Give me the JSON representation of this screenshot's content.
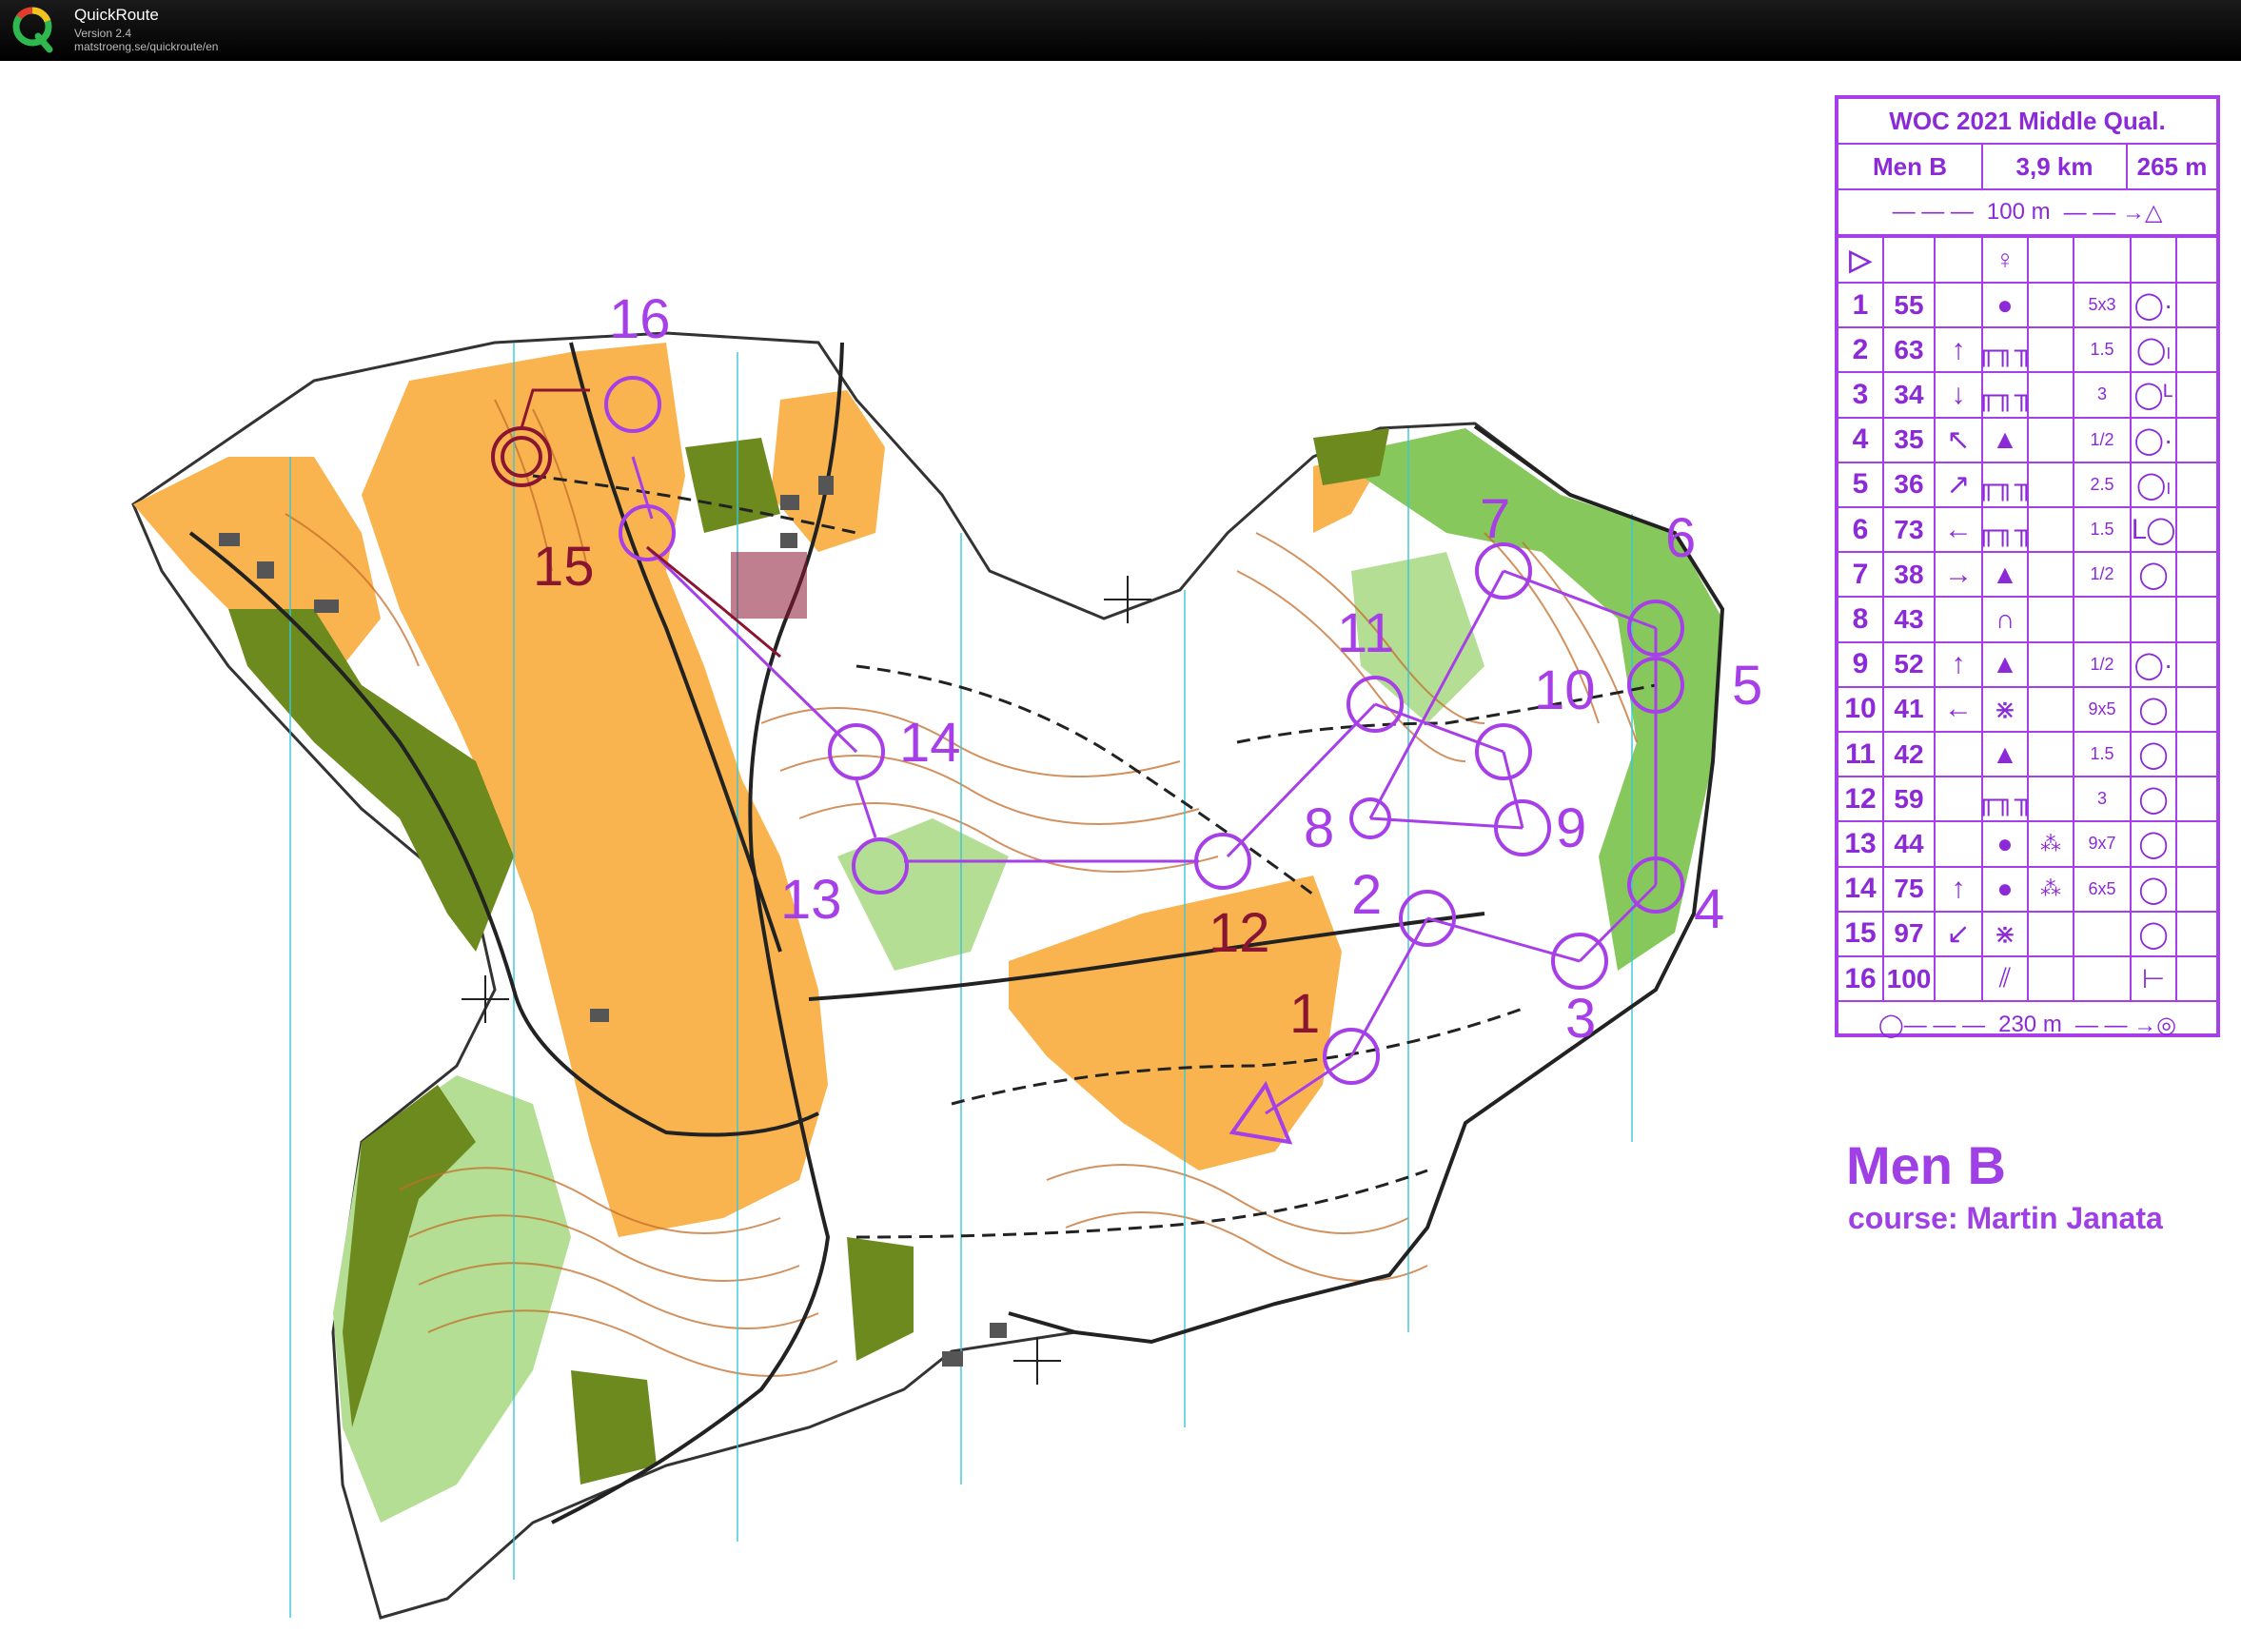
{
  "app": {
    "name": "QuickRoute",
    "version": "Version 2.4",
    "url": "matstroeng.se/quickroute/en"
  },
  "colors": {
    "course": "#a63fe8",
    "route": "#8a1531",
    "open_land": "#f9b450",
    "forest_green": "#85c55a",
    "olive": "#6d8a1f",
    "contour": "#c46e2a"
  },
  "description_sheet": {
    "event": "WOC 2021 Middle Qual.",
    "class": "Men B",
    "length": "3,9 km",
    "climb": "265 m",
    "start_to_first": "100 m",
    "finish_distance": "230 m",
    "controls": [
      {
        "num": "1",
        "code": "55",
        "dir": "",
        "feature": "●",
        "appear": "",
        "dim": "5x3",
        "loc": "◯·"
      },
      {
        "num": "2",
        "code": "63",
        "dir": "↑",
        "feature": "╓╖╖",
        "appear": "",
        "dim": "1.5",
        "loc": "◯ₗ"
      },
      {
        "num": "3",
        "code": "34",
        "dir": "↓",
        "feature": "╓╖╖",
        "appear": "",
        "dim": "3",
        "loc": "◯ᴸ"
      },
      {
        "num": "4",
        "code": "35",
        "dir": "↖",
        "feature": "▲",
        "appear": "",
        "dim": "1/2",
        "loc": "◯·"
      },
      {
        "num": "5",
        "code": "36",
        "dir": "↗",
        "feature": "╓╖╖",
        "appear": "",
        "dim": "2.5",
        "loc": "◯ₗ"
      },
      {
        "num": "6",
        "code": "73",
        "dir": "←",
        "feature": "╓╖╖",
        "appear": "",
        "dim": "1.5",
        "loc": "ᒪ◯"
      },
      {
        "num": "7",
        "code": "38",
        "dir": "→",
        "feature": "▲",
        "appear": "",
        "dim": "1/2",
        "loc": "◯"
      },
      {
        "num": "8",
        "code": "43",
        "dir": "",
        "feature": "∩",
        "appear": "",
        "dim": "",
        "loc": ""
      },
      {
        "num": "9",
        "code": "52",
        "dir": "↑",
        "feature": "▲",
        "appear": "",
        "dim": "1/2",
        "loc": "◯·"
      },
      {
        "num": "10",
        "code": "41",
        "dir": "←",
        "feature": "⋇",
        "appear": "",
        "dim": "9x5",
        "loc": "◯"
      },
      {
        "num": "11",
        "code": "42",
        "dir": "",
        "feature": "▲",
        "appear": "",
        "dim": "1.5",
        "loc": "◯"
      },
      {
        "num": "12",
        "code": "59",
        "dir": "",
        "feature": "╓╖╖",
        "appear": "",
        "dim": "3",
        "loc": "◯"
      },
      {
        "num": "13",
        "code": "44",
        "dir": "",
        "feature": "●",
        "appear": "⁂",
        "dim": "9x7",
        "loc": "◯"
      },
      {
        "num": "14",
        "code": "75",
        "dir": "↑",
        "feature": "●",
        "appear": "⁂",
        "dim": "6x5",
        "loc": "◯"
      },
      {
        "num": "15",
        "code": "97",
        "dir": "↙",
        "feature": "⋇",
        "appear": "",
        "dim": "",
        "loc": "◯"
      },
      {
        "num": "16",
        "code": "100",
        "dir": "",
        "feature": "⫽",
        "appear": "",
        "dim": "",
        "loc": "⊢"
      }
    ]
  },
  "course_info": {
    "title": "Men B",
    "setter": "course: Martin Janata"
  },
  "map_labels": {
    "c1": "1",
    "c2": "2",
    "c3": "3",
    "c4": "4",
    "c5": "5",
    "c6": "6",
    "c7": "7",
    "c8": "8",
    "c9": "9",
    "c10": "10",
    "c11": "11",
    "c12": "12",
    "c13": "13",
    "c14": "14",
    "c15": "15",
    "c16": "16"
  }
}
